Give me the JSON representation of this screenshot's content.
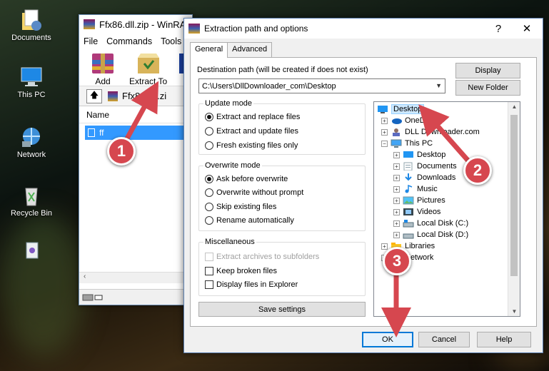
{
  "desktop": {
    "icons": [
      {
        "label": "Documents"
      },
      {
        "label": "This PC"
      },
      {
        "label": "Network"
      },
      {
        "label": "Recycle Bin"
      }
    ]
  },
  "winrar": {
    "title": "Ffx86.dll.zip - WinRA",
    "menu": [
      "File",
      "Commands",
      "Tools"
    ],
    "toolbar": {
      "add": "Add",
      "extract_to": "Extract To"
    },
    "address": "Ffx86.dll.zi",
    "column_name": "Name",
    "selected_row": "ff"
  },
  "dialog": {
    "title": "Extraction path and options",
    "help_glyph": "?",
    "close_glyph": "✕",
    "tabs": [
      "General",
      "Advanced"
    ],
    "destination_label": "Destination path (will be created if does not exist)",
    "destination_value": "C:\\Users\\DllDownloader_com\\Desktop",
    "display_button": "Display",
    "new_folder_button": "New Folder",
    "update_mode": {
      "title": "Update mode",
      "options": [
        "Extract and replace files",
        "Extract and update files",
        "Fresh existing files only"
      ],
      "selected": 0
    },
    "overwrite_mode": {
      "title": "Overwrite mode",
      "options": [
        "Ask before overwrite",
        "Overwrite without prompt",
        "Skip existing files",
        "Rename automatically"
      ],
      "selected": 0
    },
    "misc": {
      "title": "Miscellaneous",
      "options": [
        "Extract archives to subfolders",
        "Keep broken files",
        "Display files in Explorer"
      ]
    },
    "save_settings_button": "Save settings",
    "tree": [
      {
        "label": "Desktop",
        "selected": true
      },
      {
        "label": "OneDrive"
      },
      {
        "label": "DLL Downloader.com"
      },
      {
        "label": "This PC"
      },
      {
        "label": "Desktop"
      },
      {
        "label": "Documents"
      },
      {
        "label": "Downloads"
      },
      {
        "label": "Music"
      },
      {
        "label": "Pictures"
      },
      {
        "label": "Videos"
      },
      {
        "label": "Local Disk (C:)"
      },
      {
        "label": "Local Disk (D:)"
      },
      {
        "label": "Libraries"
      },
      {
        "label": "Network"
      }
    ],
    "ok_button": "OK",
    "cancel_button": "Cancel",
    "help_button": "Help"
  },
  "annotations": {
    "steps": [
      "1",
      "2",
      "3"
    ],
    "color": "#d6474f"
  }
}
